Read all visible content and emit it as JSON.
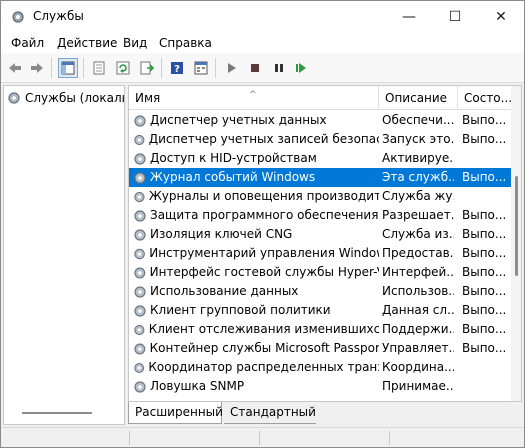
{
  "window": {
    "title": "Службы",
    "controls": {
      "minimize": "—",
      "maximize": "☐",
      "close": "✕"
    }
  },
  "menu": {
    "items": [
      "Файл",
      "Действие",
      "Вид",
      "Справка"
    ]
  },
  "toolbar": {
    "icons": [
      "back-arrow-icon",
      "forward-arrow-icon",
      "show-tree-icon",
      "properties-icon",
      "refresh-icon",
      "export-list-icon",
      "help-icon",
      "view-icon",
      "start-service-icon",
      "stop-service-icon",
      "restart-service-icon"
    ],
    "colors": {
      "play": "#2e9a3e",
      "stop": "#333333",
      "help": "#2b4ea8"
    }
  },
  "tree": {
    "root_label": "Службы (локалы"
  },
  "table": {
    "columns": [
      "Имя",
      "Описание",
      "Состо..."
    ],
    "sort_indicator": "^",
    "selected_index": 3,
    "rows": [
      {
        "name": "Диспетчер учетных данных",
        "desc": "Обеспечи...",
        "state": "Выпо..."
      },
      {
        "name": "Диспетчер учетных записей безопасн...",
        "desc": "Запуск это...",
        "state": "Выпо..."
      },
      {
        "name": "Доступ к HID-устройствам",
        "desc": "Активируе...",
        "state": ""
      },
      {
        "name": "Журнал событий Windows",
        "desc": "Эта служб...",
        "state": "Выпо..."
      },
      {
        "name": "Журналы и оповещения производите...",
        "desc": "Служба жу...",
        "state": ""
      },
      {
        "name": "Защита программного обеспечения",
        "desc": "Разрешает...",
        "state": "Выпо..."
      },
      {
        "name": "Изоляция ключей CNG",
        "desc": "Служба из...",
        "state": "Выпо..."
      },
      {
        "name": "Инструментарий управления Windows",
        "desc": "Предостав...",
        "state": "Выпо..."
      },
      {
        "name": "Интерфейс гостевой службы Hyper-V",
        "desc": "Интерфей...",
        "state": "Выпо..."
      },
      {
        "name": "Использование данных",
        "desc": "Использов...",
        "state": "Выпо..."
      },
      {
        "name": "Клиент групповой политики",
        "desc": "Данная сл...",
        "state": "Выпо..."
      },
      {
        "name": "Клиент отслеживания изменившихся ...",
        "desc": "Поддержи...",
        "state": "Выпо..."
      },
      {
        "name": "Контейнер службы Microsoft Passport",
        "desc": "Управляет...",
        "state": "Выпо..."
      },
      {
        "name": "Координатор распределенных транзак...",
        "desc": "Координа...",
        "state": ""
      },
      {
        "name": "Ловушка SNMP",
        "desc": "Принимае...",
        "state": ""
      }
    ]
  },
  "tabs": [
    "Расширенный",
    "Стандартный"
  ],
  "accent_color": "#0078d7"
}
